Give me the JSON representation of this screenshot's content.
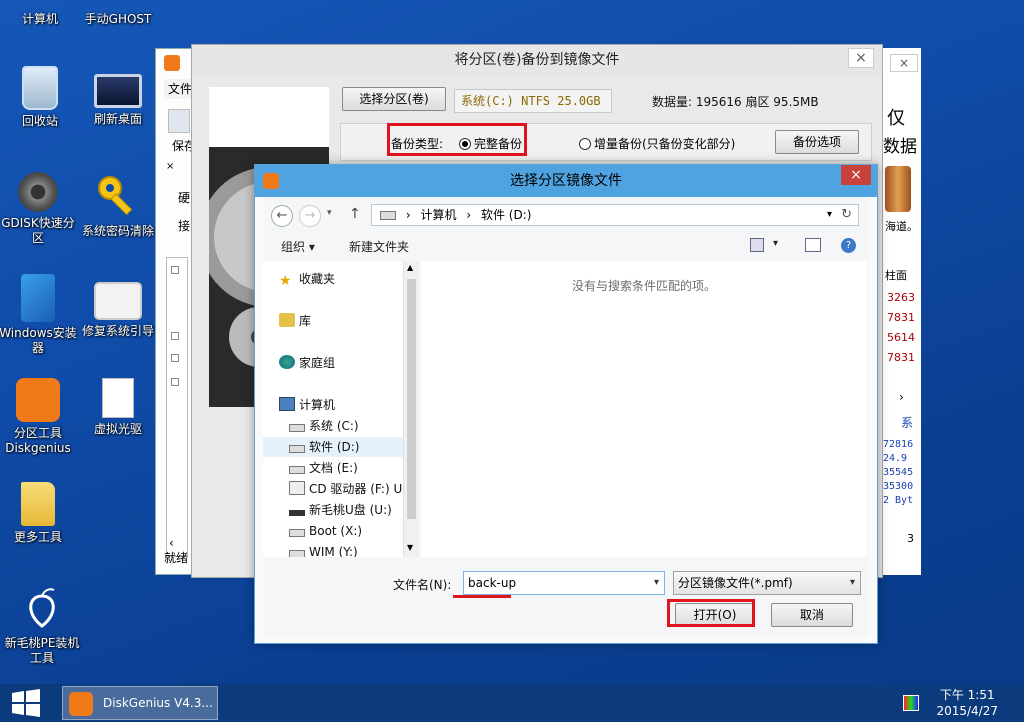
{
  "desktop": {
    "icons": [
      {
        "label": "计算机"
      },
      {
        "label": "手动GHOST"
      },
      {
        "label": "回收站"
      },
      {
        "label": "刷新桌面"
      },
      {
        "label": "GDISK快速分区"
      },
      {
        "label": "系统密码清除"
      },
      {
        "label": "Windows安装器"
      },
      {
        "label": "修复系统引导"
      },
      {
        "label": "分区工具Diskgenius"
      },
      {
        "label": "虚拟光驱"
      },
      {
        "label": "更多工具"
      },
      {
        "label": "新毛桃PE装机工具"
      }
    ]
  },
  "bg_window": {
    "menu_file": "文件",
    "tab_save": "保存",
    "side_hard": "硬",
    "side_connect": "接",
    "status": "就绪",
    "right_text_1": "仅",
    "right_text_2": "数据",
    "right_text_3": "海道。",
    "right_col_header": "柱面",
    "right_values": [
      "3263",
      "7831",
      "5614",
      "7831"
    ],
    "right_sys": "系",
    "right_nums": [
      "72816",
      "24.9",
      "35545",
      "35300",
      "2 Byt"
    ],
    "right_3": "3"
  },
  "backup_dialog": {
    "title": "将分区(卷)备份到镜像文件",
    "select_partition_button": "选择分区(卷)",
    "partition_info": "系统(C:) NTFS 25.0GB",
    "stats": "数据量: 195616 扇区   95.5MB",
    "backup_type_label": "备份类型:",
    "full_backup": "完整备份",
    "incremental_backup": "增量备份(只备份变化部分)",
    "options_button": "备份选项",
    "close": "×"
  },
  "file_dialog": {
    "title": "选择分区镜像文件",
    "close": "×",
    "address": {
      "computer": "计算机",
      "sep": "›",
      "drive": "软件 (D:)"
    },
    "toolbar": {
      "organize": "组织 ▾",
      "new_folder": "新建文件夹"
    },
    "nav": {
      "favorites": "收藏夹",
      "library": "库",
      "homegroup": "家庭组",
      "computer": "计算机",
      "drives": [
        "系统 (C:)",
        "软件 (D:)",
        "文档 (E:)",
        "CD 驱动器 (F:) U",
        "新毛桃U盘 (U:)",
        "Boot (X:)",
        "WIM (Y:)"
      ]
    },
    "empty_message": "没有与搜索条件匹配的项。",
    "filename_label": "文件名(N):",
    "filename_value": "back-up",
    "filetype_value": "分区镜像文件(*.pmf)",
    "open_button": "打开(O)",
    "cancel_button": "取消"
  },
  "taskbar": {
    "task_label": "DiskGenius V4.3...",
    "time": "下午 1:51",
    "date": "2015/4/27"
  },
  "colors": {
    "highlight_red": "#e0141e",
    "title_blue": "#4fa3e0"
  }
}
